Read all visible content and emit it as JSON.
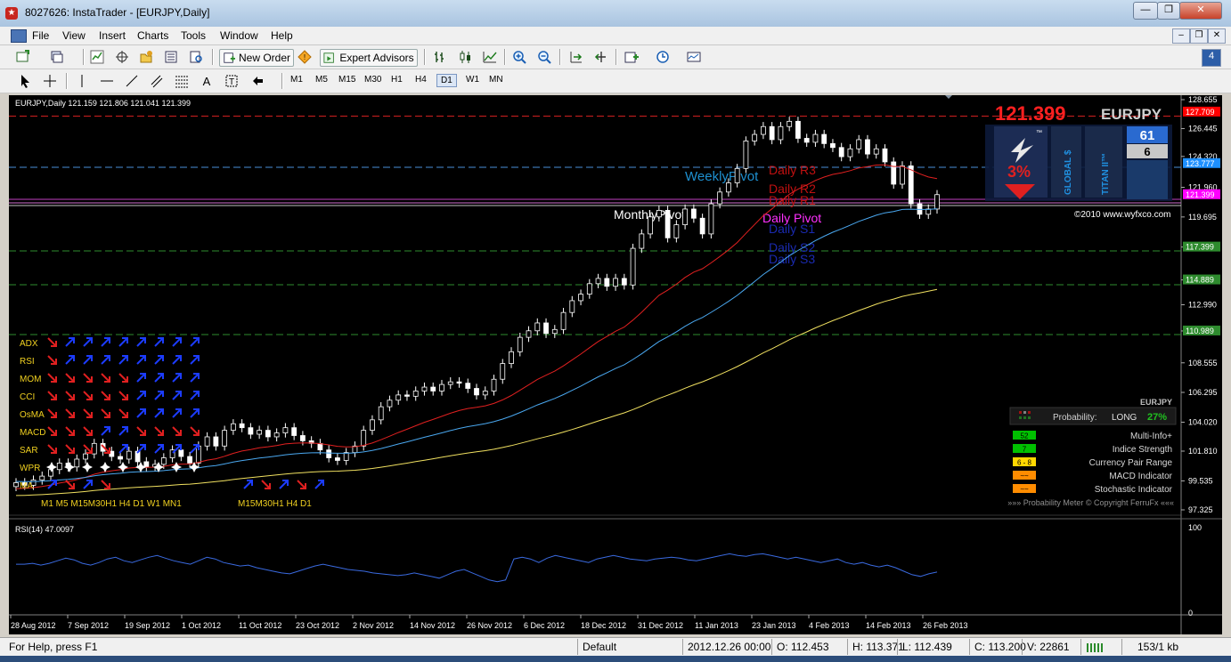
{
  "window": {
    "title": "8027626: InstaTrader - [EURJPY,Daily]"
  },
  "menu": [
    "File",
    "View",
    "Insert",
    "Charts",
    "Tools",
    "Window",
    "Help"
  ],
  "toolbar": {
    "new_order": "New Order",
    "expert_advisors": "Expert Advisors"
  },
  "timeframes": [
    "M1",
    "M5",
    "M15",
    "M30",
    "H1",
    "H4",
    "D1",
    "W1",
    "MN"
  ],
  "active_timeframe": "D1",
  "chart": {
    "header": "EURJPY,Daily  121.159 121.806 121.041 121.399",
    "price_big": "121.399",
    "symbol": "EURJPY",
    "copyright": "©2010 www.wyfxco.com",
    "price_axis": [
      "128.655",
      "126.445",
      "124.320",
      "121.960",
      "119.695",
      "117.399",
      "114.889",
      "112.990",
      "110.989",
      "108.555",
      "106.295",
      "104.020",
      "101.810",
      "99.535",
      "97.325"
    ],
    "price_tags": [
      {
        "label": "127.709",
        "color": "#ff0000",
        "price": 127.709
      },
      {
        "label": "123.777",
        "color": "#1e90ff",
        "price": 123.777
      },
      {
        "label": "121.399",
        "color": "#ff00ff",
        "price": 121.399
      },
      {
        "label": "117.399",
        "color": "#2e8b2e",
        "price": 117.399
      },
      {
        "label": "114.889",
        "color": "#2e8b2e",
        "price": 114.889
      },
      {
        "label": "110.989",
        "color": "#2e8b2e",
        "price": 110.989
      }
    ],
    "pivots": {
      "weekly": "WeeklyPivot",
      "monthly": "MonthlyPivot",
      "r3": "Daily R3",
      "r2": "Daily R2",
      "r1": "Daily R1",
      "pivot": "Daily Pivot",
      "s1": "Daily S1",
      "s2": "Daily S2",
      "s3": "Daily S3"
    },
    "panel": {
      "n1": "61",
      "n2": "6",
      "percent": "3%",
      "global": "GLOBAL $",
      "titan": "TITAN II™",
      "tm": "™"
    },
    "indicators": [
      "ADX",
      "RSI",
      "MOM",
      "CCI",
      "OsMA",
      "MACD",
      "SAR",
      "WPR",
      "MA"
    ],
    "ind_tf_left": "M1 M5 M15M30H1  H4  D1  W1 MN1",
    "ind_tf_right": "M15M30H1  H4  D1",
    "prob": {
      "symbol": "EURJPY",
      "probability": "Probability:",
      "direction": "LONG",
      "pct": "27%",
      "rows": [
        {
          "badge": "52",
          "label": "Multi-Info+",
          "color": "#00c000"
        },
        {
          "badge": "7",
          "label": "Indice Strength",
          "color": "#00c000"
        },
        {
          "badge": "6 - 8",
          "label": "Currency Pair Range",
          "color": "#ffd700"
        },
        {
          "badge": "~~",
          "label": "MACD Indicator",
          "color": "#ff8c00"
        },
        {
          "badge": "~~",
          "label": "Stochastic Indicator",
          "color": "#ff8c00"
        }
      ],
      "footer": "»»» Probability Meter © Copyright FerruFx «««"
    },
    "rsi": {
      "header": "RSI(14) 47.0097",
      "axis_top": "100",
      "axis_bottom": "0",
      "values": [
        56,
        56,
        57,
        55,
        57,
        60,
        63,
        61,
        57,
        55,
        58,
        62,
        64,
        60,
        58,
        61,
        64,
        66,
        63,
        60,
        58,
        56,
        60,
        64,
        62,
        58,
        56,
        54,
        55,
        52,
        50,
        48,
        46,
        45,
        48,
        51,
        54,
        56,
        54,
        52,
        50,
        49,
        48,
        46,
        45,
        44,
        43,
        44,
        46,
        44,
        42,
        40,
        44,
        48,
        50,
        46,
        42,
        38,
        36,
        38,
        62,
        64,
        62,
        58,
        63,
        66,
        64,
        62,
        60,
        58,
        62,
        64,
        66,
        64,
        62,
        61,
        60,
        62,
        63,
        64,
        63,
        61,
        60,
        62,
        64,
        66,
        68,
        66,
        65,
        67,
        68,
        66,
        64,
        62,
        64,
        62,
        60,
        58,
        60,
        62,
        58,
        56,
        58,
        55,
        53,
        55,
        52,
        48,
        44,
        42,
        45,
        47
      ]
    },
    "dates": [
      "28 Aug 2012",
      "7 Sep 2012",
      "19 Sep 2012",
      "1 Oct 2012",
      "11 Oct 2012",
      "23 Oct 2012",
      "2 Nov 2012",
      "14 Nov 2012",
      "26 Nov 2012",
      "6 Dec 2012",
      "18 Dec 2012",
      "31 Dec 2012",
      "11 Jan 2013",
      "23 Jan 2013",
      "4 Feb 2013",
      "14 Feb 2013",
      "26 Feb 2013"
    ]
  },
  "chart_data": {
    "type": "line",
    "title": "EURJPY,Daily",
    "price_range": [
      97.325,
      128.655
    ],
    "closes": [
      99.4,
      99.2,
      99.6,
      99.9,
      100.4,
      100.9,
      100.6,
      101.2,
      101.6,
      102.4,
      101.8,
      101.4,
      101.2,
      101.8,
      101.0,
      100.6,
      100.8,
      101.3,
      101.9,
      101.4,
      100.9,
      102.2,
      102.9,
      102.2,
      103.4,
      103.9,
      103.6,
      103.1,
      103.4,
      102.9,
      103.2,
      103.6,
      103.0,
      102.6,
      102.4,
      101.9,
      101.3,
      101.1,
      101.7,
      102.2,
      103.4,
      104.2,
      105.2,
      105.7,
      106.1,
      106.0,
      106.4,
      106.7,
      106.4,
      106.9,
      107.1,
      107.0,
      106.6,
      106.1,
      106.4,
      107.3,
      108.5,
      109.4,
      110.5,
      111.0,
      111.6,
      110.8,
      111.1,
      112.4,
      113.3,
      113.8,
      114.6,
      115.0,
      114.4,
      115.0,
      114.5,
      117.3,
      118.4,
      119.7,
      120.2,
      118.1,
      119.1,
      120.3,
      119.6,
      118.4,
      120.7,
      121.6,
      122.3,
      123.4,
      125.5,
      126.0,
      126.6,
      125.6,
      126.6,
      127.0,
      125.7,
      125.4,
      126.0,
      125.3,
      125.0,
      124.3,
      124.9,
      125.6,
      124.5,
      124.9,
      123.9,
      122.2,
      123.6,
      120.7,
      119.9,
      120.3,
      121.4
    ],
    "moving_averages": [
      "red",
      "deepskyblue",
      "yellow"
    ]
  }
}
